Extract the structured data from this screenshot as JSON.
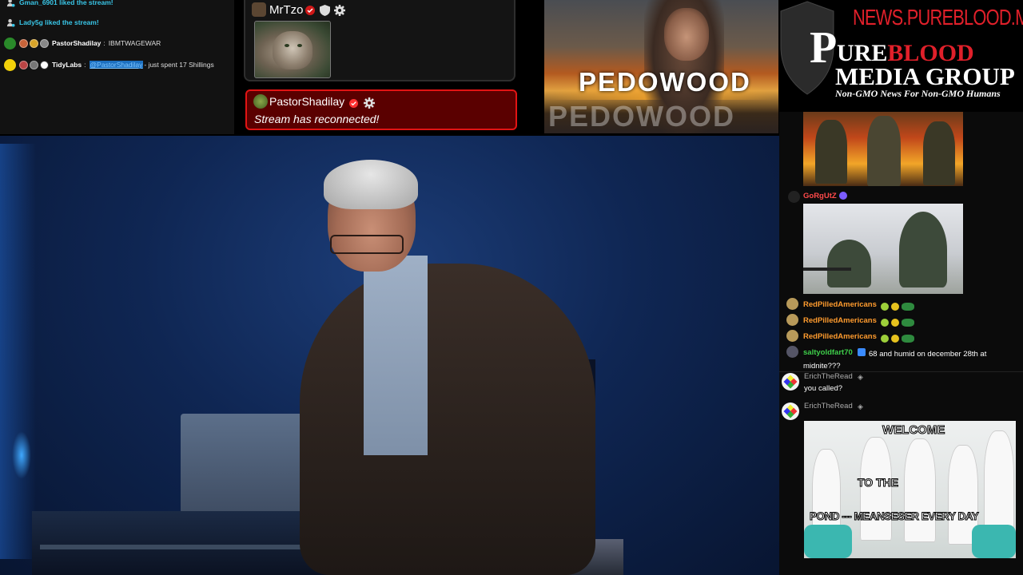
{
  "activity": {
    "rows": [
      {
        "text": "Gman_6901 liked the stream!"
      },
      {
        "text": "Lady5g liked the stream!"
      },
      {
        "user": "PastorShadilay",
        "sep": ":",
        "message": "IBMTWAGEWAR"
      },
      {
        "user": "TidyLabs",
        "sep": ":",
        "mention": "@PastorShadilay",
        "message": "- just spent 17 Shillings"
      }
    ]
  },
  "mrtzo_card": {
    "username": "MrTzo"
  },
  "reconnect": {
    "username": "PastorShadilay",
    "message": "Stream has reconnected!"
  },
  "banner": {
    "word": "PEDOWOOD"
  },
  "logo": {
    "url": "NEWS.PUREBLOOD.MEDIA",
    "line1": "PUREBLOOD",
    "line2": "MEDIA GROUP",
    "tagline": "Non-GMO News For Non-GMO Humans"
  },
  "chat": {
    "gorgutz": "GoRgUtZ",
    "rpa": [
      "RedPilledAmericans",
      "RedPilledAmericans",
      "RedPilledAmericans"
    ],
    "salty_user": "saltyoldfart70",
    "salty_msg": "68 and humid on december 28th at midnite???",
    "erich1": "ErichTheRead",
    "erich1_msg": "you called?",
    "erich2": "ErichTheRead",
    "meme": {
      "line1": "WELCOME",
      "line2": "TO THE",
      "line3": "POND --- MEANSESER EVERY DAY"
    }
  },
  "colors": {
    "cyan": "#39c6e8",
    "alert_red": "#e21414",
    "logo_red": "#e0202a",
    "chat_orange": "#ff9b2e",
    "chat_green": "#3ecf4a",
    "chat_red": "#ff4a4a"
  }
}
